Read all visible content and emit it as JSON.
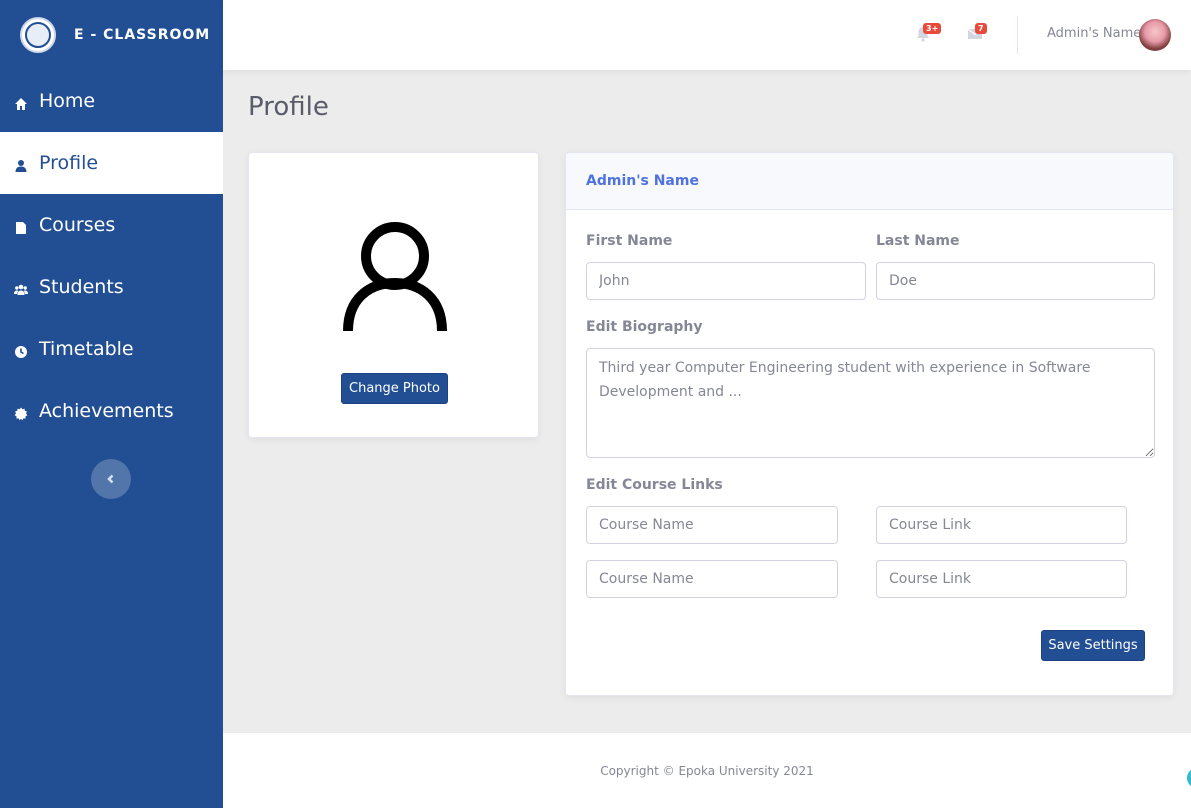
{
  "brand": {
    "name": "E - CLASSROOM",
    "logo_icon": "university-seal-icon"
  },
  "sidebar": {
    "items": [
      {
        "label": "Home",
        "icon": "home-icon",
        "active": false
      },
      {
        "label": "Profile",
        "icon": "user-icon",
        "active": true
      },
      {
        "label": "Courses",
        "icon": "file-icon",
        "active": false
      },
      {
        "label": "Students",
        "icon": "users-icon",
        "active": false
      },
      {
        "label": "Timetable",
        "icon": "clock-icon",
        "active": false
      },
      {
        "label": "Achievements",
        "icon": "badge-icon",
        "active": false
      }
    ],
    "collapse_icon": "chevron-left-icon"
  },
  "topbar": {
    "alerts_badge": "3+",
    "messages_badge": "7",
    "user_name": "Admin's Name"
  },
  "page": {
    "title": "Profile"
  },
  "photo_card": {
    "button_label": "Change Photo"
  },
  "form": {
    "header": "Admin's Name",
    "first_name_label": "First Name",
    "first_name_placeholder": "John",
    "last_name_label": "Last Name",
    "last_name_placeholder": "Doe",
    "bio_label": "Edit Biography",
    "bio_placeholder": "Third year Computer Engineering student with experience in Software Development and ...",
    "links_label": "Edit Course Links",
    "course_name_placeholder": "Course Name",
    "course_link_placeholder": "Course Link",
    "save_label": "Save Settings"
  },
  "footer": {
    "copyright": "Copyright © Epoka University 2021"
  },
  "colors": {
    "sidebar": "#224f93",
    "accent": "#4e73df",
    "badge": "#e74a3b",
    "background": "#ececec"
  }
}
